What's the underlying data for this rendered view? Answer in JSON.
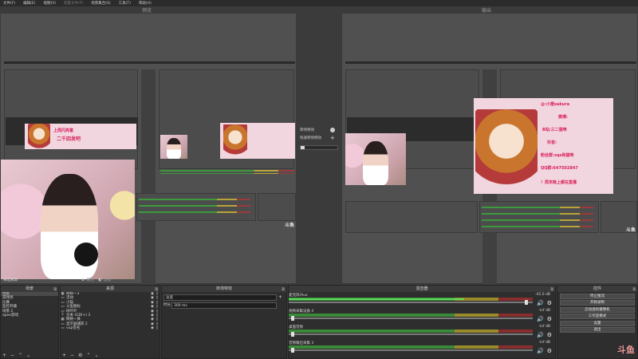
{
  "menu": {
    "items": [
      "文件(F)",
      "编辑(E)",
      "视图(V)",
      "配置文件(P)",
      "场景集合(S)",
      "工具(T)",
      "帮助(H)"
    ]
  },
  "preview": {
    "label": "预览"
  },
  "program": {
    "label": "输出"
  },
  "overlay": {
    "banner_left": "上周闪亮富",
    "banner_left_sub": "二千四发吧",
    "banner_lines": [
      "@:小橙sakura",
      "微博:",
      "B站:三二猫咪",
      "抖音:",
      "粉丝群:sqs和猫咪",
      "QQ群:647502847",
      "！周末晚上都在直播"
    ],
    "watermark_small": "斗鱼"
  },
  "transition_mid": {
    "row1": "转场特效",
    "row2": "快速转场特效"
  },
  "status": {
    "no_source": "未选择源",
    "properties": "属性",
    "filters": "滤镜"
  },
  "docks": {
    "scenes": {
      "title": "场景",
      "items": [
        "场景",
        "游戏场",
        "比赛",
        "监控开播",
        "场景 2",
        "apex游戏"
      ],
      "selected": 0
    },
    "sources": {
      "title": "来源",
      "items": [
        {
          "icon": "▦",
          "label": "网络一3"
        },
        {
          "icon": "▭",
          "label": "活动"
        },
        {
          "icon": "▭",
          "label": "小猫"
        },
        {
          "icon": "▭",
          "label": "斗鱼图标"
        },
        {
          "icon": "▭",
          "label": "树叶叶"
        },
        {
          "icon": "T",
          "label": "文本 (GDI+) 3"
        },
        {
          "icon": "▦",
          "label": "网络一真"
        },
        {
          "icon": "▭",
          "label": "显示器捕获 2"
        },
        {
          "icon": "▭",
          "label": "vup签名"
        }
      ]
    },
    "transitions": {
      "title": "转场特效",
      "current": "淡变",
      "duration_label": "时长",
      "duration_value": "300 ms"
    },
    "mixer": {
      "title": "混音器",
      "channels": [
        {
          "name": "麦克风/Aux",
          "db": "-45.0 dB",
          "level": 0.72,
          "volume": 0.98
        },
        {
          "name": "视频采集设备 4",
          "db": "-inf dB",
          "level": 0.0,
          "volume": 0.01
        },
        {
          "name": "桌面音频",
          "db": "-inf dB",
          "level": 0.0,
          "volume": 0.01
        },
        {
          "name": "音频输出采集 3",
          "db": "-inf dB",
          "level": 0.0,
          "volume": 0.01
        }
      ]
    },
    "controls": {
      "title": "控件",
      "buttons": [
        "停止推流",
        "开始录制",
        "启动虚拟摄像机",
        "工作室模式",
        "设置",
        "退出"
      ]
    }
  },
  "watermark": "斗鱼"
}
